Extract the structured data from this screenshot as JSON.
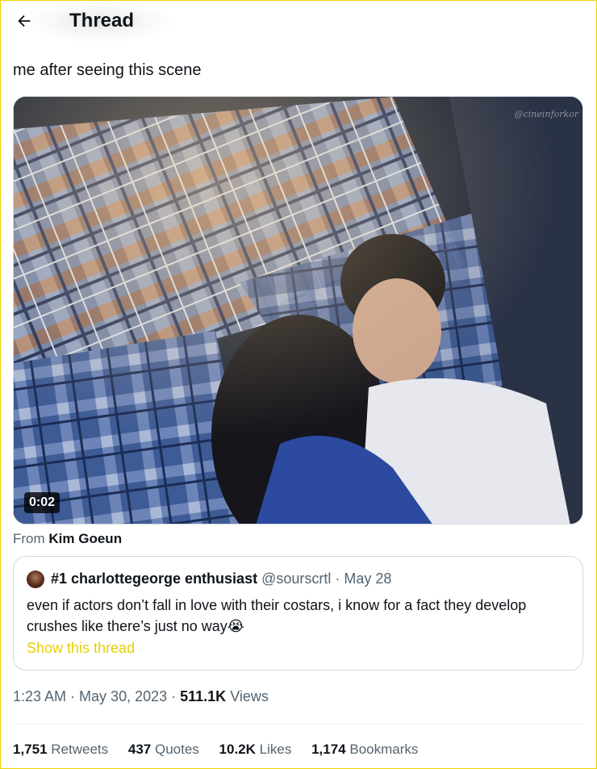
{
  "header": {
    "title": "Thread",
    "back_icon": "arrow-left-icon"
  },
  "tweet": {
    "text": "me after seeing this scene",
    "video": {
      "duration": "0:02",
      "watermark": "@cineinforkor"
    },
    "from_prefix": "From",
    "from_name": "Kim Goeun"
  },
  "quote": {
    "display_name": "#1 charlottegeorge enthusiast",
    "handle": "@sourscrtl",
    "separator": " · ",
    "date": "May 28",
    "text": "even if actors don’t fall in love with their costars, i know for a fact they develop crushes like there’s just no way",
    "emoji": "😭",
    "show_thread": "Show this thread"
  },
  "meta": {
    "time": "1:23 AM",
    "sep": " · ",
    "date": "May 30, 2023",
    "views_count": "511.1K",
    "views_label": "Views"
  },
  "stats": {
    "retweets_count": "1,751",
    "retweets_label": "Retweets",
    "quotes_count": "437",
    "quotes_label": "Quotes",
    "likes_count": "10.2K",
    "likes_label": "Likes",
    "bookmarks_count": "1,174",
    "bookmarks_label": "Bookmarks"
  },
  "colors": {
    "link": "#e8cf00",
    "muted": "#536471",
    "frame": "#ecd400"
  }
}
